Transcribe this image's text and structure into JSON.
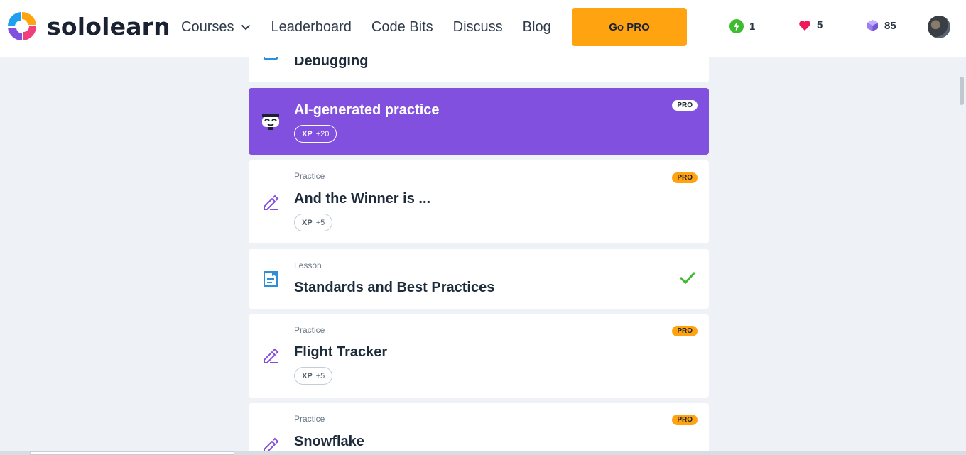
{
  "brand": {
    "name": "sololearn"
  },
  "nav": {
    "courses": "Courses",
    "leaderboard": "Leaderboard",
    "code_bits": "Code Bits",
    "discuss": "Discuss",
    "blog": "Blog"
  },
  "go_pro": "Go PRO",
  "stats": {
    "streak": "1",
    "hearts": "5",
    "gems": "85"
  },
  "colors": {
    "accent": "#8250df",
    "pro": "#ffa310",
    "check": "#3ebb30",
    "lesson_icon": "#2e8fd9"
  },
  "cards": [
    {
      "type": "",
      "title": "Debugging",
      "icon": "lesson-icon"
    },
    {
      "type": "",
      "title": "AI-generated practice",
      "xp_label": "XP",
      "xp_value": "+20",
      "badge": "PRO",
      "icon": "robot-icon"
    },
    {
      "type": "Practice",
      "title": "And the Winner is ...",
      "xp_label": "XP",
      "xp_value": "+5",
      "badge": "PRO",
      "icon": "pencil-icon"
    },
    {
      "type": "Lesson",
      "title": "Standards and Best Practices",
      "status": "completed",
      "icon": "lesson-icon"
    },
    {
      "type": "Practice",
      "title": "Flight Tracker",
      "xp_label": "XP",
      "xp_value": "+5",
      "badge": "PRO",
      "icon": "pencil-icon"
    },
    {
      "type": "Practice",
      "title": "Snowflake",
      "badge": "PRO",
      "icon": "pencil-icon"
    }
  ]
}
